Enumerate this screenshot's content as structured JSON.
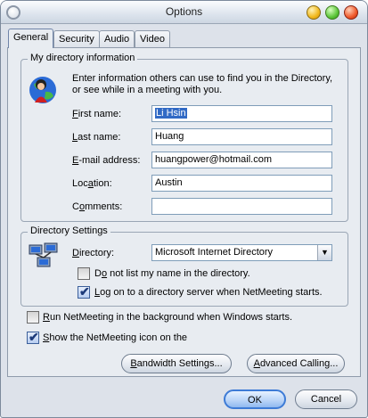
{
  "window": {
    "title": "Options"
  },
  "tabs": [
    "General",
    "Security",
    "Audio",
    "Video"
  ],
  "directory_info": {
    "legend": "My directory information",
    "description_line1": "Enter information others can use to find you in the Directory,",
    "description_line2": "or see while in a meeting with you.",
    "fields": [
      {
        "label": "First name:",
        "accel": "F",
        "rest": "irst name:",
        "value": "Li Hsin"
      },
      {
        "label": "Last name:",
        "accel": "L",
        "rest": "ast name:",
        "value": "Huang"
      },
      {
        "label": "E-mail address:",
        "accel": "E",
        "rest": "-mail address:",
        "value": "huangpower@hotmail.com"
      },
      {
        "label": "Location:",
        "pre": "Loc",
        "accel": "a",
        "rest": "tion:",
        "value": "Austin"
      },
      {
        "label": "Comments:",
        "pre": "C",
        "accel": "o",
        "rest": "mments:",
        "value": ""
      }
    ]
  },
  "directory_settings": {
    "legend": "Directory Settings",
    "directory_label_accel": "D",
    "directory_label_rest": "irectory:",
    "directory_value": "Microsoft Internet Directory",
    "dont_list_pre": "D",
    "dont_list_accel": "o",
    "dont_list_rest": " not list my name in the directory.",
    "dont_list_checked": false,
    "logon_accel": "L",
    "logon_rest": "og on to a directory server when NetMeeting starts.",
    "logon_checked": true
  },
  "general": {
    "run_background_accel": "R",
    "run_background_rest": "un NetMeeting in the background when Windows starts.",
    "run_background_checked": false,
    "show_icon_accel": "S",
    "show_icon_rest": "how the NetMeeting icon on the",
    "show_icon_checked": true
  },
  "buttons": {
    "bandwidth_accel": "B",
    "bandwidth_rest": "andwidth Settings...",
    "advanced_accel": "A",
    "advanced_rest": "dvanced Calling...",
    "ok": "OK",
    "cancel": "Cancel"
  }
}
